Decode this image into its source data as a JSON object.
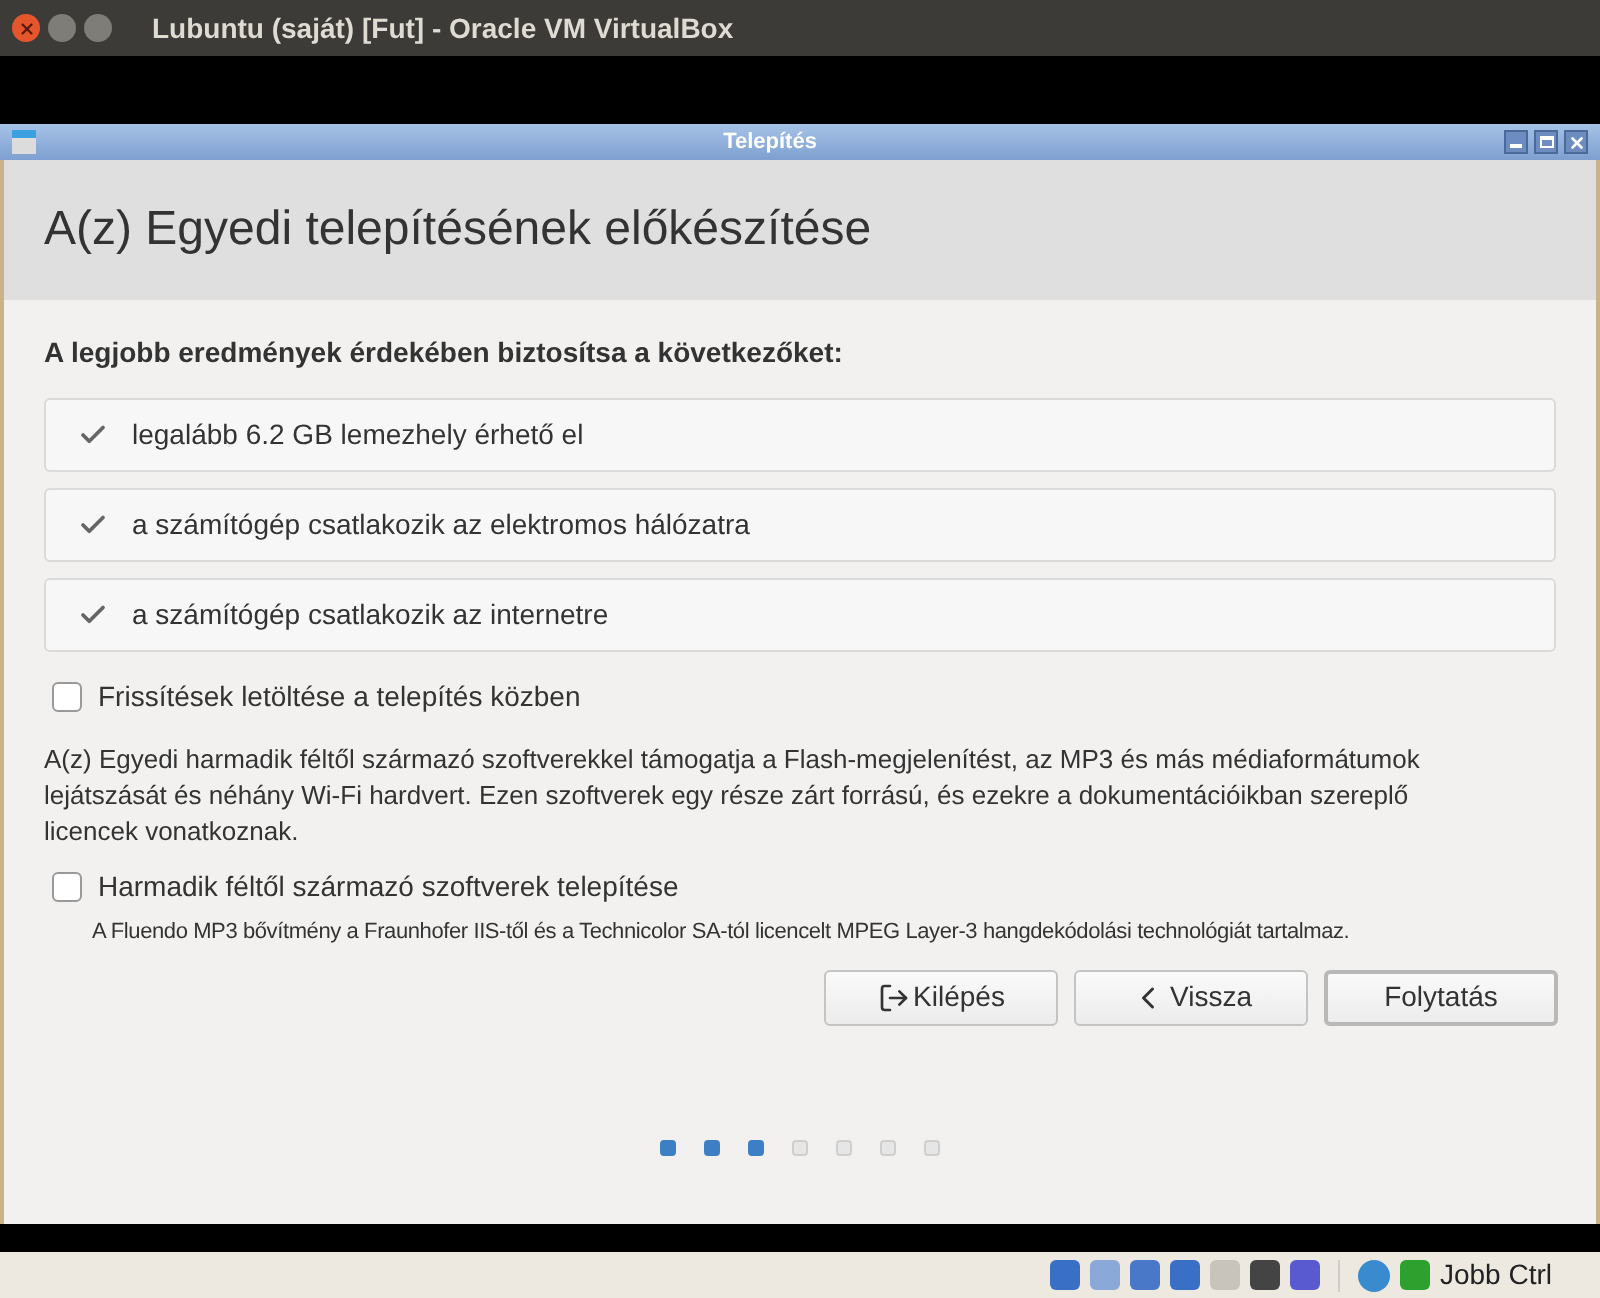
{
  "host_window": {
    "title": "Lubuntu (saját) [Fut] - Oracle VM VirtualBox"
  },
  "installer_window": {
    "title": "Telepítés"
  },
  "header": {
    "title": "A(z) Egyedi telepítésének előkészítése"
  },
  "requirements": {
    "heading": "A legjobb eredmények érdekében biztosítsa a következőket:",
    "items": [
      {
        "label": "legalább 6.2 GB lemezhely érhető el",
        "checked": true
      },
      {
        "label": "a számítógép csatlakozik az elektromos hálózatra",
        "checked": true
      },
      {
        "label": "a számítógép csatlakozik az internetre",
        "checked": true
      }
    ]
  },
  "download_updates": {
    "label": "Frissítések letöltése a telepítés közben",
    "checked": false
  },
  "third_party": {
    "description": "A(z) Egyedi harmadik féltől származó szoftverekkel támogatja a Flash-megjelenítést, az MP3 és más médiaformátumok lejátszását és néhány Wi-Fi hardvert. Ezen szoftverek egy része zárt forrású, és ezekre a dokumentációikban szereplő licencek vonatkoznak.",
    "label": "Harmadik féltől származó szoftverek telepítése",
    "checked": false,
    "note": "A Fluendo MP3 bővítmény a Fraunhofer IIS-től és a Technicolor SA-tól licencelt MPEG Layer-3 hangdekódolási technológiát tartalmaz."
  },
  "buttons": [
    {
      "label": "Kilépés",
      "kind": "quit"
    },
    {
      "label": "Vissza",
      "kind": "back"
    },
    {
      "label": "Folytatás",
      "kind": "default"
    }
  ],
  "progress_steps": [
    {
      "done": true
    },
    {
      "done": true
    },
    {
      "done": true
    },
    {
      "done": false
    },
    {
      "done": false
    },
    {
      "done": false
    },
    {
      "done": false
    }
  ],
  "status_bar": {
    "host_key": "Jobb Ctrl"
  }
}
